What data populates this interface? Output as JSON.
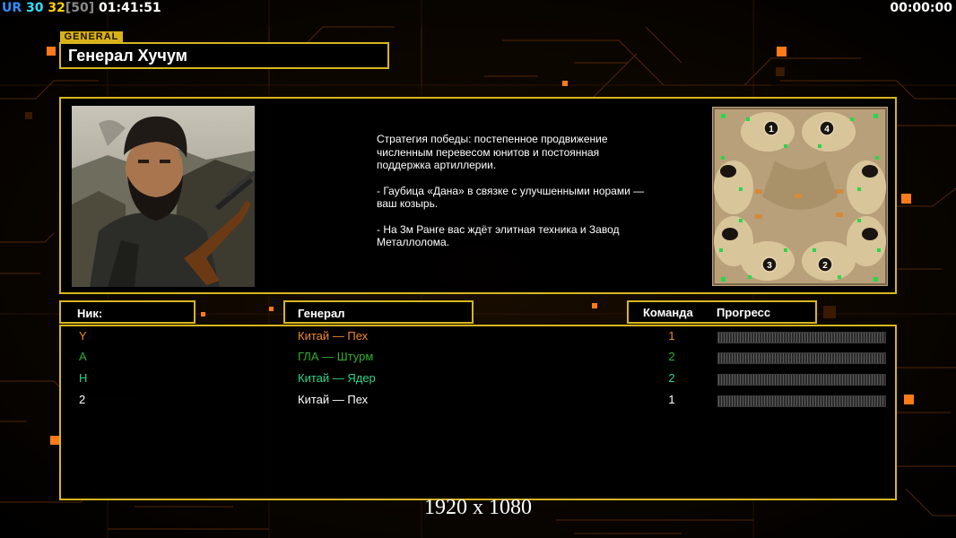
{
  "hud": {
    "ur_label": "UR",
    "fps": "30",
    "units": "32",
    "units_max": "[50]",
    "clock": "01:41:51",
    "timer": "00:00:00"
  },
  "general_tag": "GENERAL",
  "general_name": "Генерал Хучум",
  "strategy": {
    "p1": "Стратегия победы: постепенное продвижение численным перевесом юнитов и постоянная поддержка артиллерии.",
    "p2": "- Гаубица «Дана» в связке с улучшенными норами — ваш козырь.",
    "p3": "- На 3м Ранге вас ждёт элитная техника и Завод Металлолома."
  },
  "map": {
    "spawns": [
      "1",
      "4",
      "3",
      "2"
    ]
  },
  "table": {
    "col_nick": "Ник:",
    "col_general": "Генерал",
    "col_team": "Команда",
    "col_progress": "Прогресс",
    "rows": [
      {
        "nick": "Y",
        "general": "Китай — Пех",
        "team": "1",
        "color": "#f08a2a",
        "progress": 0
      },
      {
        "nick": "A",
        "general": "ГЛА — Штурм",
        "team": "2",
        "color": "#2fb02f",
        "progress": 0
      },
      {
        "nick": "H",
        "general": "Китай — Ядер",
        "team": "2",
        "color": "#29d68a",
        "progress": 0
      },
      {
        "nick": "2",
        "general": "Китай — Пех",
        "team": "1",
        "color": "#ffffff",
        "progress": 0
      }
    ]
  },
  "resolution": "1920 x 1080",
  "colors": {
    "accent_gold": "#d7b51e",
    "hud_orange": "#ff7a1a"
  }
}
